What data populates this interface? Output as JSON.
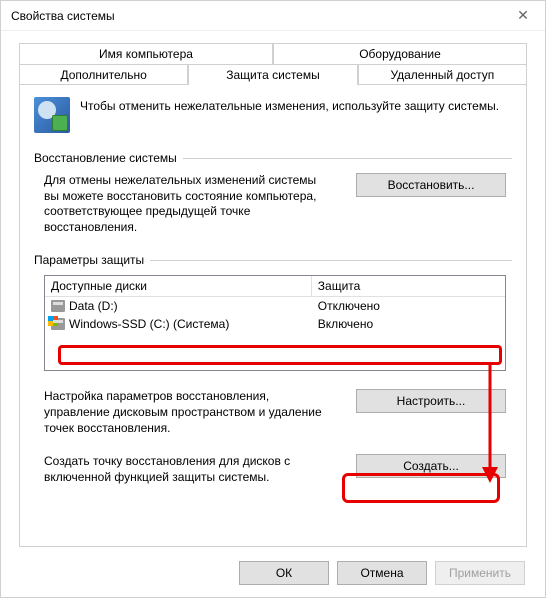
{
  "window": {
    "title": "Свойства системы"
  },
  "tabs": {
    "row1": [
      "Имя компьютера",
      "Оборудование"
    ],
    "row2": [
      "Дополнительно",
      "Защита системы",
      "Удаленный доступ"
    ],
    "active": "Защита системы"
  },
  "intro_text": "Чтобы отменить нежелательные изменения, используйте защиту системы.",
  "restore_section": {
    "title": "Восстановление системы",
    "text": "Для отмены нежелательных изменений системы вы можете восстановить состояние компьютера, соответствующее предыдущей точке восстановления.",
    "button": "Восстановить..."
  },
  "protect_section": {
    "title": "Параметры защиты",
    "columns": [
      "Доступные диски",
      "Защита"
    ],
    "rows": [
      {
        "name": "Data (D:)",
        "status": "Отключено",
        "flag": false
      },
      {
        "name": "Windows-SSD (C:) (Система)",
        "status": "Включено",
        "flag": true
      }
    ],
    "config_text": "Настройка параметров восстановления, управление дисковым пространством и удаление точек восстановления.",
    "config_button": "Настроить...",
    "create_text": "Создать точку восстановления для дисков с включенной функцией защиты системы.",
    "create_button": "Создать..."
  },
  "dialog_buttons": {
    "ok": "ОК",
    "cancel": "Отмена",
    "apply": "Применить"
  }
}
